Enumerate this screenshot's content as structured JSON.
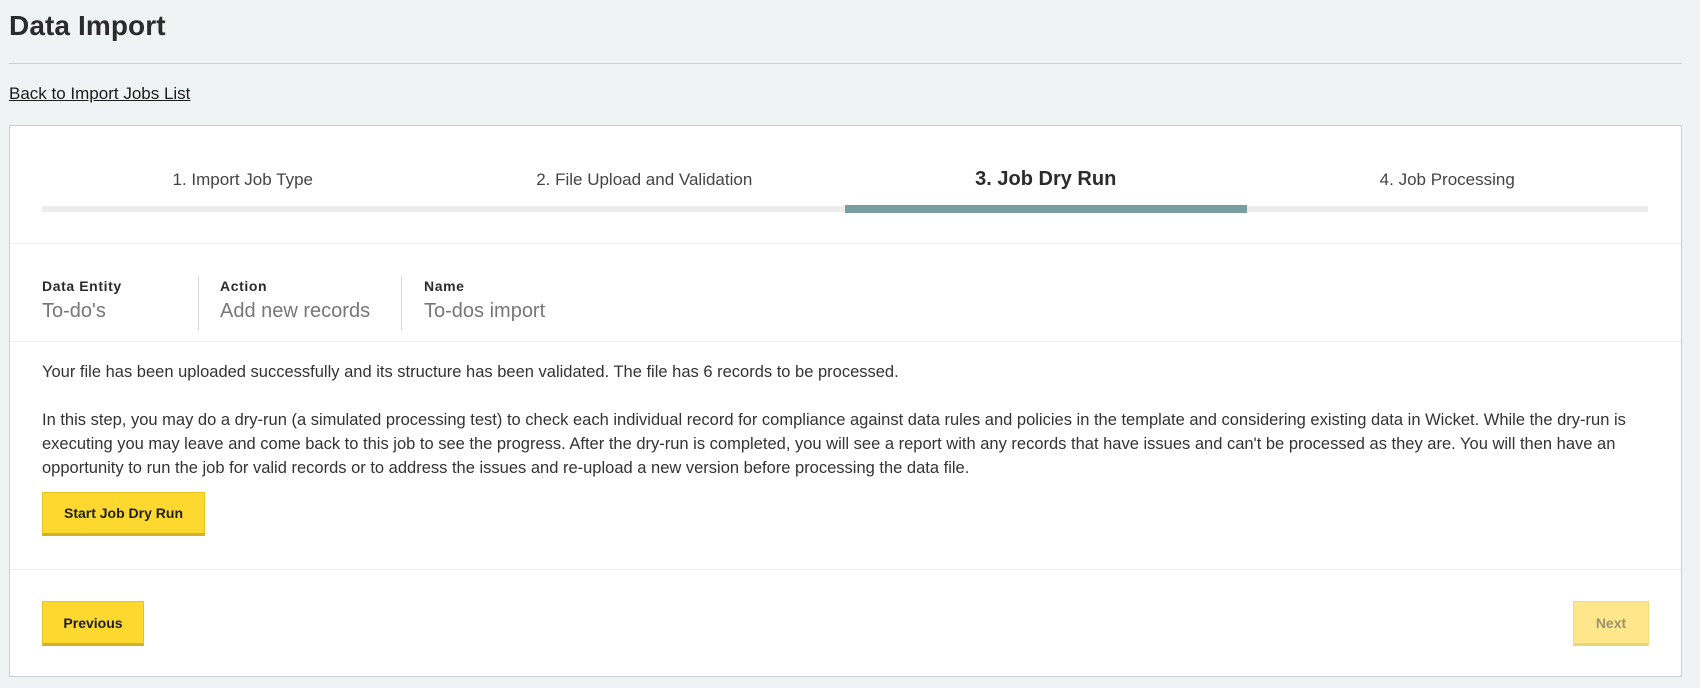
{
  "page": {
    "title": "Data Import",
    "back_link": "Back to Import Jobs List"
  },
  "steps": [
    {
      "label": "1. Import Job Type",
      "active": false
    },
    {
      "label": "2. File Upload and Validation",
      "active": false
    },
    {
      "label": "3. Job Dry Run",
      "active": true
    },
    {
      "label": "4. Job Processing",
      "active": false
    }
  ],
  "job": {
    "data_entity": {
      "label": "Data Entity",
      "value": "To-do's"
    },
    "action": {
      "label": "Action",
      "value": "Add new records"
    },
    "name": {
      "label": "Name",
      "value": "To-dos import"
    }
  },
  "content": {
    "upload_message": "Your file has been uploaded successfully and its structure has been validated. The file has 6 records to be processed.",
    "dry_run_description": "In this step, you may do a dry-run (a simulated processing test) to check each individual record for compliance against data rules and policies in the template and considering existing data in Wicket. While the dry-run is executing you may leave and come back to this job to see the progress. After the dry-run is completed, you will see a report with any records that have issues and can't be processed as they are. You will then have an opportunity to run the job for valid records or to address the issues and re-upload a new version before processing the data file."
  },
  "buttons": {
    "start_dry_run": "Start Job Dry Run",
    "previous": "Previous",
    "next": "Next",
    "next_disabled": true
  },
  "colors": {
    "accent_button": "#fdd92f",
    "active_step_bar": "#7a9ea0",
    "page_background": "#f0f3f3"
  }
}
